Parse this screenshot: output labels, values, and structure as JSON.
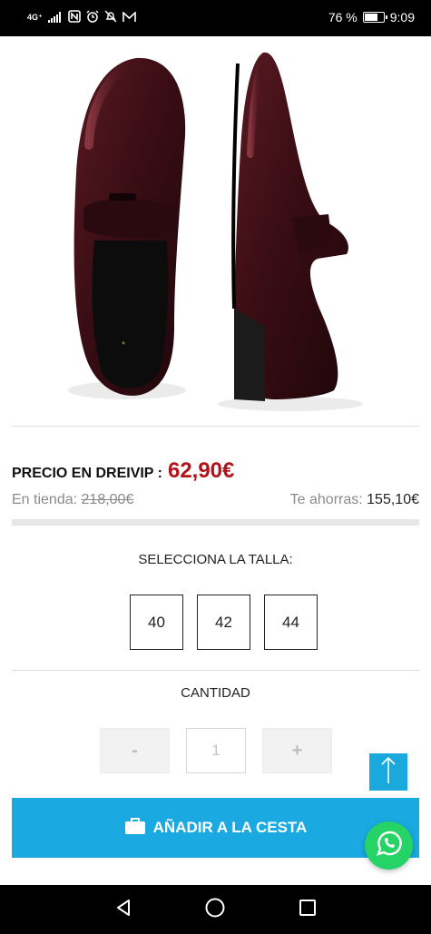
{
  "status_bar": {
    "network": "4G⁺",
    "battery_percent": "76 %",
    "battery_level": 0.76,
    "time": "9:09"
  },
  "product": {
    "price_label": "PRECIO EN DREIVIP :",
    "price": "62,90€",
    "store_label": "En tienda:",
    "store_price": "218,00€",
    "save_label": "Te ahorras:",
    "save_value": "155,10€"
  },
  "size": {
    "title": "SELECCIONA LA TALLA:",
    "options": [
      "40",
      "42",
      "44"
    ]
  },
  "quantity": {
    "title": "CANTIDAD",
    "minus": "-",
    "value": "1",
    "plus": "+"
  },
  "cart": {
    "button_label": "AÑADIR A LA CESTA"
  },
  "colors": {
    "price": "#b3131b",
    "accent": "#1aa9e1",
    "whatsapp": "#25d366"
  },
  "icons": [
    "signal-icon",
    "nfc-icon",
    "alarm-icon",
    "mute-icon",
    "gmail-icon",
    "battery-icon",
    "briefcase-icon",
    "arrow-up-icon",
    "whatsapp-icon",
    "back-icon",
    "home-icon",
    "recents-icon"
  ]
}
